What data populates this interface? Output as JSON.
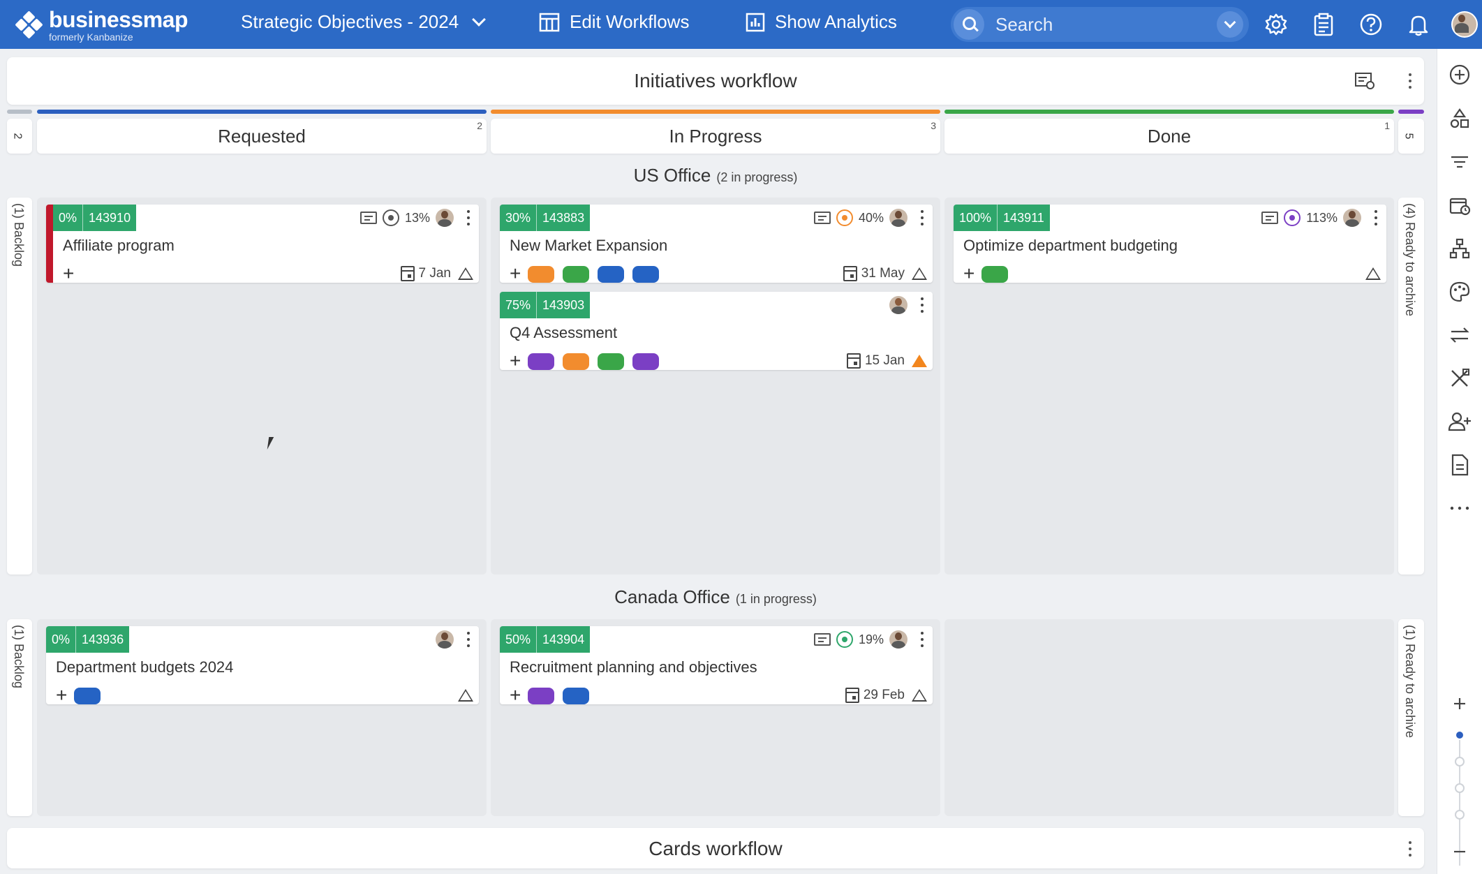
{
  "topbar": {
    "logo_name": "businessmap",
    "logo_sub": "formerly Kanbanize",
    "board": "Strategic Objectives - 2024",
    "edit_workflows": "Edit Workflows",
    "show_analytics": "Show Analytics",
    "search_placeholder": "Search",
    "icons": [
      "gear-icon",
      "clipboard-icon",
      "help-icon",
      "bell-icon",
      "avatar"
    ]
  },
  "workflow": {
    "title": "Initiatives workflow",
    "columns": [
      {
        "title": "Requested",
        "count": "2",
        "color": "#2c5fbf"
      },
      {
        "title": "In Progress",
        "count": "3",
        "color": "#f28c2e"
      },
      {
        "title": "Done",
        "count": "1",
        "color": "#3aa648"
      }
    ],
    "left_count": "2",
    "right_count": "5",
    "left_bar_color": "#b7bec7",
    "right_bar_color": "#7b3fc4"
  },
  "lanes": [
    {
      "name": "US Office",
      "note": "(2 in progress)",
      "left": "(1) Backlog",
      "right": "(4) Ready to archive"
    },
    {
      "name": "Canada Office",
      "note": "(1 in progress)",
      "left": "(1) Backlog",
      "right": "(1) Ready to archive"
    }
  ],
  "cards": {
    "c143910": {
      "pct": "0%",
      "id": "143910",
      "title": "Affiliate program",
      "progress": "13%",
      "due": "7 Jan"
    },
    "c143883": {
      "pct": "30%",
      "id": "143883",
      "title": "New Market Expansion",
      "progress": "40%",
      "due": "31 May"
    },
    "c143903": {
      "pct": "75%",
      "id": "143903",
      "title": "Q4 Assessment",
      "due": "15 Jan"
    },
    "c143911": {
      "pct": "100%",
      "id": "143911",
      "title": "Optimize department budgeting",
      "progress": "113%"
    },
    "c143936": {
      "pct": "0%",
      "id": "143936",
      "title": "Department budgets 2024"
    },
    "c143904": {
      "pct": "50%",
      "id": "143904",
      "title": "Recruitment planning and objectives",
      "progress": "19%",
      "due": "29 Feb"
    }
  },
  "tag_colors": {
    "orange": "#f28c2e",
    "green": "#3aa648",
    "blue": "#2563c4",
    "purple": "#7b3fc4"
  },
  "target_colors": {
    "gray": "#555555",
    "orange": "#f28c2e",
    "purple": "#7b3fc4",
    "green": "#2ea66b"
  },
  "workflow2": {
    "title": "Cards workflow"
  },
  "rail_icons": [
    "add-icon",
    "shapes-icon",
    "filter-icon",
    "calendar-clock-icon",
    "hierarchy-icon",
    "palette-icon",
    "swap-icon",
    "tools-icon",
    "add-user-icon",
    "document-icon",
    "more-icon",
    "zoom-in-icon",
    "zoom-out-icon"
  ]
}
